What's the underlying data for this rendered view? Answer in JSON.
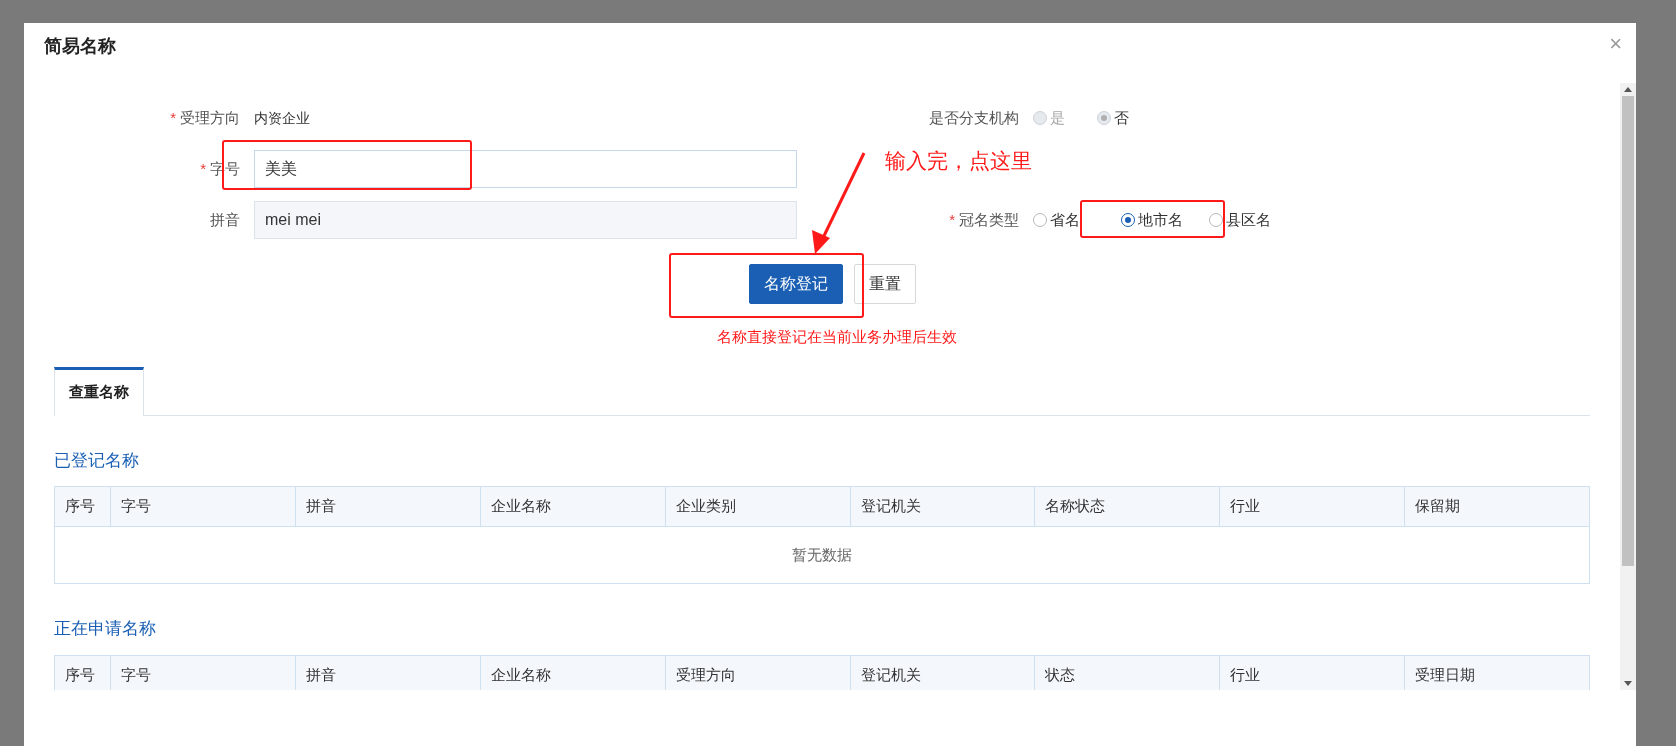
{
  "dialog": {
    "title": "简易名称",
    "close": "×"
  },
  "form": {
    "left": [
      {
        "kind": "text",
        "required_mark": "*",
        "label": "受理方向",
        "value": "内资企业"
      },
      {
        "kind": "input",
        "required_mark": "*",
        "label": "字号",
        "value": "美美",
        "disabled": false
      },
      {
        "kind": "input",
        "label": "拼音",
        "value": "mei mei",
        "disabled": true
      }
    ],
    "right": [
      {
        "kind": "radio",
        "label": "是否分支机构",
        "disabled": true,
        "options": [
          {
            "label": "是",
            "selected": false
          },
          {
            "label": "否",
            "selected": true
          }
        ]
      },
      {
        "kind": "empty"
      },
      {
        "kind": "radio",
        "required_mark": "*",
        "label": "冠名类型",
        "disabled": false,
        "options": [
          {
            "label": "省名",
            "selected": false
          },
          {
            "label": "地市名",
            "selected": true
          },
          {
            "label": "县区名",
            "selected": false
          }
        ]
      }
    ]
  },
  "buttons": [
    {
      "label": "名称登记",
      "primary": true
    },
    {
      "label": "重置",
      "primary": false
    }
  ],
  "note": "名称直接登记在当前业务办理后生效",
  "tabs": [
    {
      "label": "查重名称",
      "selected": true
    }
  ],
  "sections": [
    {
      "title": "已登记名称",
      "table": {
        "columns": [
          "序号",
          "字号",
          "拼音",
          "企业名称",
          "企业类别",
          "登记机关",
          "名称状态",
          "行业",
          "保留期"
        ],
        "empty": "暂无数据"
      }
    },
    {
      "title": "正在申请名称",
      "table": {
        "columns": [
          "序号",
          "字号",
          "拼音",
          "企业名称",
          "受理方向",
          "登记机关",
          "状态",
          "行业",
          "受理日期"
        ]
      }
    }
  ],
  "annotation": {
    "text": "输入完，点这里"
  }
}
